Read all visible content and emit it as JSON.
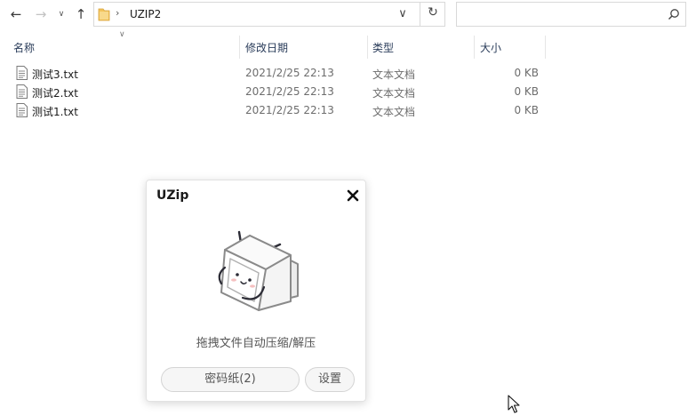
{
  "nav": {
    "back_glyph": "←",
    "forward_glyph": "→",
    "recent_glyph": "∨",
    "up_glyph": "↑"
  },
  "address": {
    "separator": "›",
    "path": "UZIP2",
    "dropdown_glyph": "∨",
    "refresh_glyph": "↻"
  },
  "search": {
    "value": "",
    "placeholder": ""
  },
  "columns": {
    "sort_indicator": "∨",
    "name": "名称",
    "date": "修改日期",
    "type": "类型",
    "size": "大小"
  },
  "files": [
    {
      "name": "测试3.txt",
      "date": "2021/2/25 22:13",
      "type": "文本文档",
      "size": "0 KB"
    },
    {
      "name": "测试2.txt",
      "date": "2021/2/25 22:13",
      "type": "文本文档",
      "size": "0 KB"
    },
    {
      "name": "测试1.txt",
      "date": "2021/2/25 22:13",
      "type": "文本文档",
      "size": "0 KB"
    }
  ],
  "dialog": {
    "title": "UZip",
    "hint": "拖拽文件自动压缩/解压",
    "password_button": "密码纸(2)",
    "settings_button": "设置"
  },
  "colors": {
    "folder": "#f2c35b",
    "header_text": "#2a3c5a",
    "muted_text": "#6d6d6d",
    "mascot_stroke": "#8a8a8a",
    "mascot_dark": "#2b2b35"
  }
}
